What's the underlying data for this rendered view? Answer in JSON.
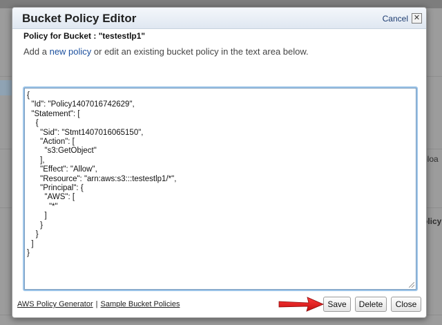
{
  "background": {
    "side_text_1": "ploa",
    "side_text_2": "olicy"
  },
  "dialog": {
    "title": "Bucket Policy Editor",
    "cancel_label": "Cancel",
    "close_glyph": "✕",
    "policy_label": "Policy for Bucket : \"testestlp1\"",
    "instructions_pre": "Add a ",
    "instructions_link": "new policy",
    "instructions_post": " or edit an existing bucket policy in the text area below.",
    "policy_text": "{\n  \"Id\": \"Policy1407016742629\",\n  \"Statement\": [\n    {\n      \"Sid\": \"Stmt1407016065150\",\n      \"Action\": [\n        \"s3:GetObject\"\n      ],\n      \"Effect\": \"Allow\",\n      \"Resource\": \"arn:aws:s3:::testestlp1/*\",\n      \"Principal\": {\n        \"AWS\": [\n          \"*\"\n        ]\n      }\n    }\n  ]\n}",
    "footer": {
      "generator_link": "AWS Policy Generator",
      "separator": "|",
      "samples_link": "Sample Bucket Policies"
    },
    "buttons": {
      "save": "Save",
      "delete": "Delete",
      "close": "Close"
    }
  },
  "colors": {
    "link": "#1b4f9e",
    "annotation_arrow": "#e01b1b",
    "editor_focus": "#9cc4e8"
  }
}
